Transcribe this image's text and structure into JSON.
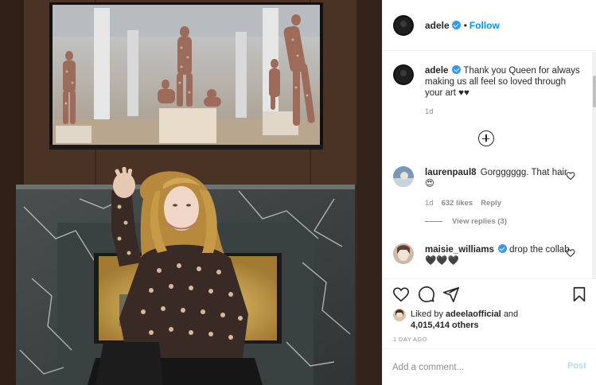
{
  "post_author": {
    "username": "adele",
    "verified": true,
    "separator": "•",
    "follow_label": "Follow"
  },
  "caption": {
    "username": "adele",
    "text": "Thank you Queen for always making us all feel so loved through your art ♥♥",
    "time": "1d"
  },
  "comments": [
    {
      "username": "laurenpaul8",
      "text": "Gorgggggg. That hair 😍",
      "time": "1d",
      "likes": "632 likes",
      "reply_label": "Reply",
      "view_replies": "View replies (3)"
    },
    {
      "username": "maisie_williams",
      "verified": true,
      "text": "drop the collab 🖤🖤🖤"
    }
  ],
  "actions": {
    "like_icon": "heart-icon",
    "comment_icon": "comment-icon",
    "share_icon": "share-icon",
    "save_icon": "bookmark-icon"
  },
  "likes_summary": {
    "prefix": "Liked by",
    "user": "adeelaofficial",
    "and": "and",
    "others": "4,015,414 others"
  },
  "timestamp": "1 DAY AGO",
  "comment_box": {
    "placeholder": "Add a comment...",
    "post_label": "Post"
  },
  "colors": {
    "accent": "#0095f6",
    "verified": "#3897f0",
    "muted": "#8e8e8e",
    "post_disabled": "#b3dbff"
  }
}
